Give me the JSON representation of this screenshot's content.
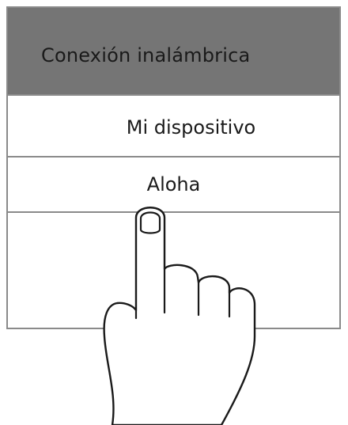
{
  "panel": {
    "header": {
      "title": "Conexión inalámbrica"
    },
    "items": [
      {
        "label": "Mi dispositivo"
      },
      {
        "label": "Aloha"
      }
    ]
  },
  "icons": {
    "hand": "pointing-hand-icon"
  },
  "colors": {
    "header_bg": "#757575",
    "border": "#8a8a8a",
    "text": "#1a1a1a"
  }
}
